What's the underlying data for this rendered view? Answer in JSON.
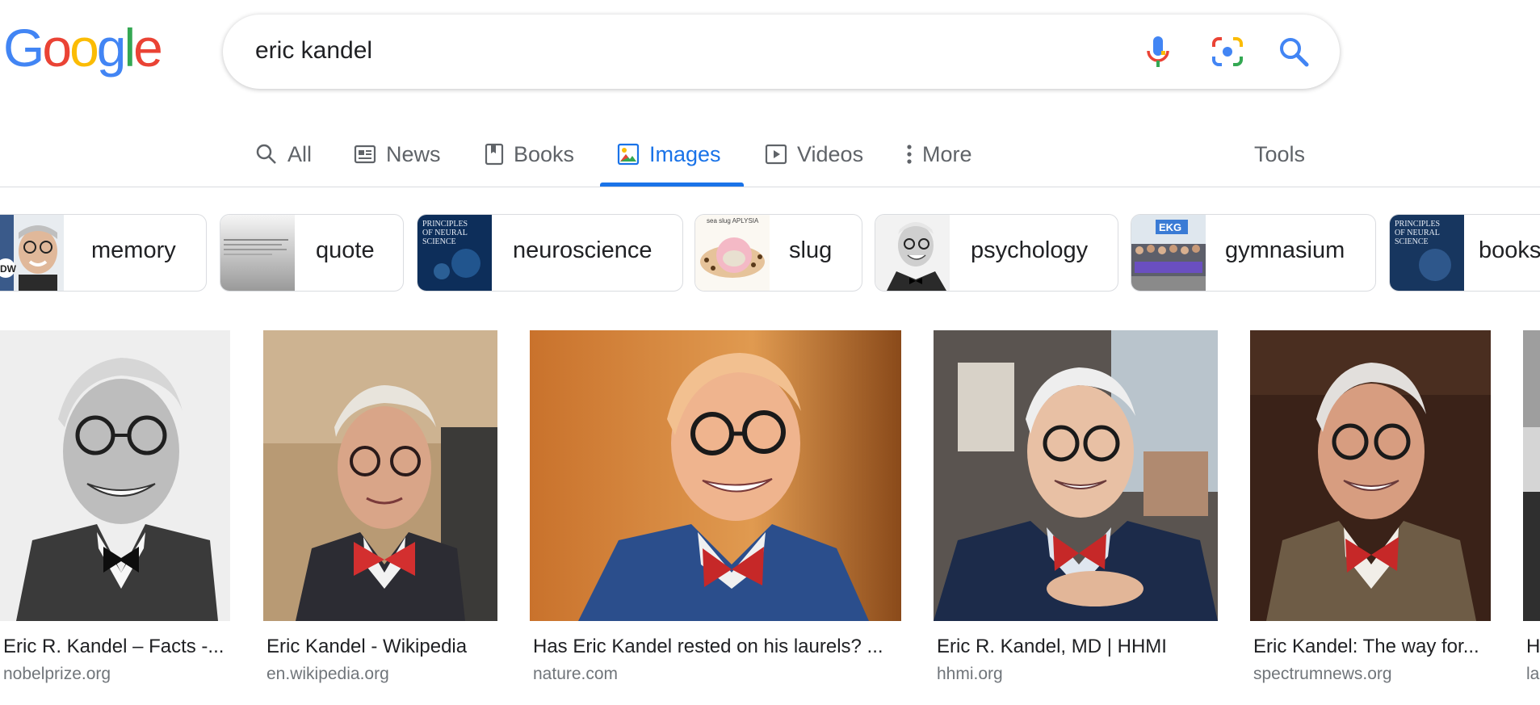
{
  "logo": {
    "letters": [
      "G",
      "o",
      "o",
      "g",
      "l",
      "e"
    ],
    "colors": [
      "#4285f4",
      "#ea4335",
      "#fbbc05",
      "#4285f4",
      "#34a853",
      "#ea4335"
    ]
  },
  "search": {
    "query": "eric kandel"
  },
  "tabs": [
    {
      "label": "All",
      "icon": "search-icon"
    },
    {
      "label": "News",
      "icon": "newspaper-icon"
    },
    {
      "label": "Books",
      "icon": "book-icon"
    },
    {
      "label": "Images",
      "icon": "image-icon",
      "active": true
    },
    {
      "label": "Videos",
      "icon": "play-icon"
    },
    {
      "label": "More",
      "icon": "more-vert-icon"
    }
  ],
  "tools_label": "Tools",
  "chips": [
    {
      "label": "memory"
    },
    {
      "label": "quote"
    },
    {
      "label": "neuroscience",
      "thumb_text": "PRINCIPLES OF NEURAL SCIENCE"
    },
    {
      "label": "slug",
      "thumb_text": "sea slug APLYSIA"
    },
    {
      "label": "psychology"
    },
    {
      "label": "gymnasium",
      "thumb_text": "EKG"
    },
    {
      "label": "books",
      "thumb_text": "PRINCIPLES OF NEURAL SCIENCE"
    }
  ],
  "results": [
    {
      "title": "Eric R. Kandel – Facts -...",
      "source": "nobelprize.org"
    },
    {
      "title": "Eric Kandel - Wikipedia",
      "source": "en.wikipedia.org"
    },
    {
      "title": "Has Eric Kandel rested on his laurels? ...",
      "source": "nature.com"
    },
    {
      "title": "Eric R. Kandel, MD | HHMI",
      "source": "hhmi.org"
    },
    {
      "title": "Eric Kandel: The way for...",
      "source": "spectrumnews.org"
    },
    {
      "title": "H",
      "source": "la"
    }
  ],
  "colors": {
    "accent": "#1a73e8",
    "tab_text": "#5f6368",
    "source_text": "#70757a",
    "bowtie_red": "#d32f2f"
  }
}
